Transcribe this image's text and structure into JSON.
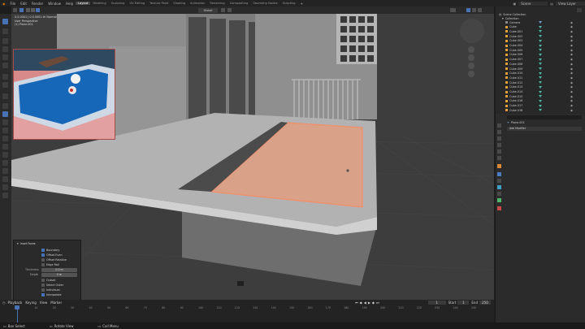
{
  "menu": [
    "File",
    "Edit",
    "Render",
    "Window",
    "Help"
  ],
  "workspaces": [
    {
      "label": "Layout",
      "active": true
    },
    {
      "label": "Modeling",
      "active": false
    },
    {
      "label": "Sculpting",
      "active": false
    },
    {
      "label": "UV Editing",
      "active": false
    },
    {
      "label": "Texture Paint",
      "active": false
    },
    {
      "label": "Shading",
      "active": false
    },
    {
      "label": "Animation",
      "active": false
    },
    {
      "label": "Rendering",
      "active": false
    },
    {
      "label": "Compositing",
      "active": false
    },
    {
      "label": "Geometry Nodes",
      "active": false
    },
    {
      "label": "Scripting",
      "active": false
    }
  ],
  "top_right": {
    "scene": "Scene",
    "view_layer": "View Layer"
  },
  "viewport": {
    "header_mode": "Global",
    "overlay_info": "0.0.0001 | 0.0.0001 tri Normal",
    "perspective": "User Perspective",
    "object_label": "(1) Plane.001"
  },
  "outliner": {
    "root": "Scene Collection",
    "collection": "Collection",
    "items": [
      "Camera",
      "Cube",
      "Cube.001",
      "Cube.002",
      "Cube.003",
      "Cube.004",
      "Cube.005",
      "Cube.006",
      "Cube.007",
      "Cube.008",
      "Cube.009",
      "Cube.010",
      "Cube.011",
      "Cube.012",
      "Cube.013",
      "Cube.014",
      "Cube.015",
      "Cube.016",
      "Cube.017",
      "Cube.018"
    ]
  },
  "properties": {
    "object_name": "Plane.001",
    "add_modifier": "Add Modifier"
  },
  "operator_panel": {
    "title": "Inset Faces",
    "boundary": "Boundary",
    "offset_even": "Offset Even",
    "offset_relative": "Offset Relative",
    "edge_rail": "Edge Rail",
    "thickness_label": "Thickness",
    "thickness_value": "0.0 m",
    "depth_label": "Depth",
    "depth_value": "0 m",
    "outset": "Outset",
    "select_outer": "Select Outer",
    "individual": "Individual",
    "interpolate": "Interpolate"
  },
  "timeline": {
    "menu": [
      "Playback",
      "Keying",
      "View",
      "Marker"
    ],
    "current_frame": "1",
    "start_label": "Start",
    "start": "1",
    "end_label": "End",
    "end": "250",
    "ticks": [
      "0",
      "10",
      "20",
      "30",
      "40",
      "50",
      "60",
      "70",
      "80",
      "90",
      "100",
      "110",
      "120",
      "130",
      "140",
      "150",
      "160",
      "170",
      "180",
      "190",
      "200",
      "210",
      "220",
      "230",
      "240",
      "250"
    ]
  },
  "status": {
    "select": "Box Select",
    "rotate": "Rotate View",
    "menu": "Call Menu"
  },
  "colors": {
    "accent": "#4772b3",
    "selected_face": "#d9a187",
    "outline_edge": "#f28e6a",
    "collection_tri": "#4fb7a5",
    "pool": "#1767b8",
    "slab": "#b2b2b2"
  }
}
